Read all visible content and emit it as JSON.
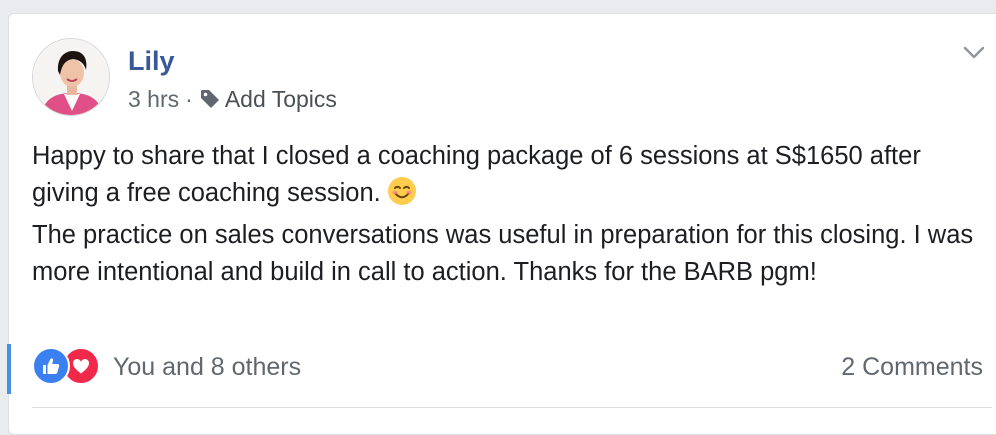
{
  "post": {
    "author": "Lily",
    "time": "3 hrs",
    "separator": "·",
    "add_topics": "Add Topics",
    "paragraphs": [
      "Happy to share that I closed a coaching package of 6 sessions at S$1650 after giving a free coaching session.",
      "The practice on sales conversations was useful in preparation for this closing. I was more intentional and build in call to action. Thanks for the BARB pgm!"
    ],
    "emoji": "smiling-face-icon"
  },
  "reactions": {
    "icons": [
      "like-icon",
      "love-icon"
    ],
    "summary": "You and 8 others",
    "comments": "2 Comments"
  },
  "colors": {
    "author": "#385898",
    "like": "#3b80f0",
    "love": "#f0284a",
    "meta_text": "#606770"
  }
}
